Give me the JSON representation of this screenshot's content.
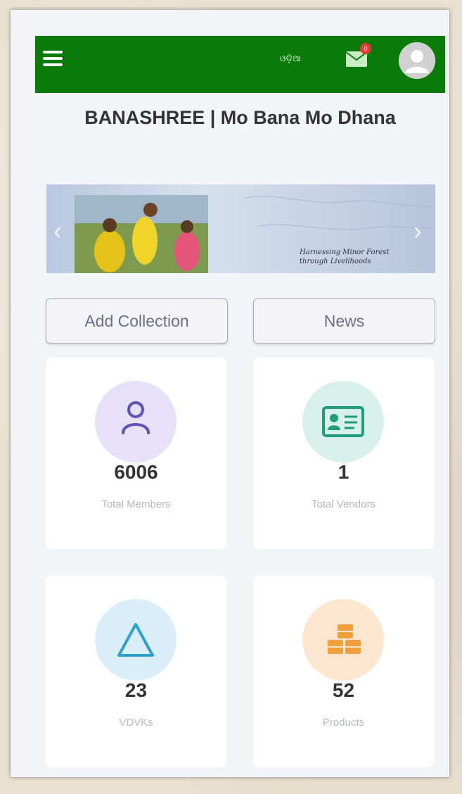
{
  "appbar": {
    "language_label": "ଓଡ଼ିଆ",
    "notification_count": "0"
  },
  "page": {
    "title": "BANASHREE | Mo Bana Mo Dhana"
  },
  "banner": {
    "caption_line1": "Harnessing Minor Forest",
    "caption_line2": "through Livelihoods"
  },
  "actions": {
    "add_collection": "Add Collection",
    "news": "News"
  },
  "stats": [
    {
      "value": "6006",
      "label": "Total Members",
      "icon": "user-icon",
      "color": "#e6e0f8",
      "icon_color": "#5c52b8"
    },
    {
      "value": "1",
      "label": "Total Vendors",
      "icon": "id-card-icon",
      "color": "#d7f1ea",
      "icon_color": "#1f9c7c"
    },
    {
      "value": "23",
      "label": "VDVKs",
      "icon": "triangle-icon",
      "color": "#d9eef8",
      "icon_color": "#2f9fcf"
    },
    {
      "value": "52",
      "label": "Products",
      "icon": "boxes-icon",
      "color": "#fde6cf",
      "icon_color": "#f0a03a"
    }
  ],
  "colors": {
    "appbar": "#0a7a08",
    "background": "#f3f4f8"
  }
}
